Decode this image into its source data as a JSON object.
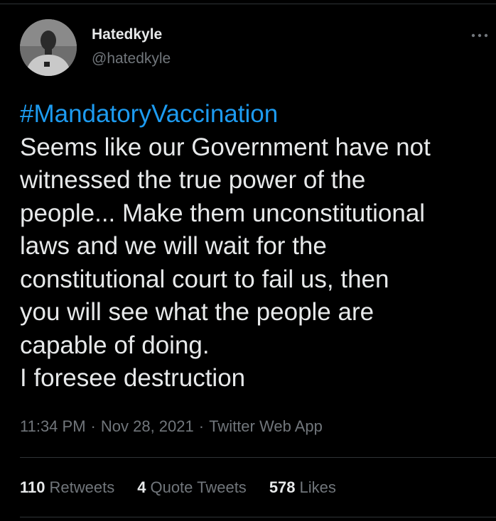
{
  "author": {
    "display_name": "Hatedkyle",
    "handle": "@hatedkyle"
  },
  "tweet": {
    "hashtag": "#MandatoryVaccination",
    "lines": [
      "Seems like our Government have not",
      "witnessed the true power of the",
      "people...  Make them unconstitutional",
      "laws and we will wait for the",
      "constitutional court to fail us, then",
      "you will see what the people are",
      "capable of doing.",
      "I foresee destruction"
    ]
  },
  "meta": {
    "time": "11:34 PM",
    "separator": "·",
    "date": "Nov 28, 2021",
    "source": "Twitter Web App"
  },
  "stats": {
    "retweets_count": "110",
    "retweets_label": "Retweets",
    "quotes_count": "4",
    "quotes_label": "Quote Tweets",
    "likes_count": "578",
    "likes_label": "Likes"
  },
  "icons": {
    "more": "more-horizontal-icon",
    "avatar": "avatar-photo"
  },
  "colors": {
    "background": "#000000",
    "text_primary": "#e7e9ea",
    "text_secondary": "#71767b",
    "link": "#1d9bf0",
    "border": "#2f3336"
  }
}
